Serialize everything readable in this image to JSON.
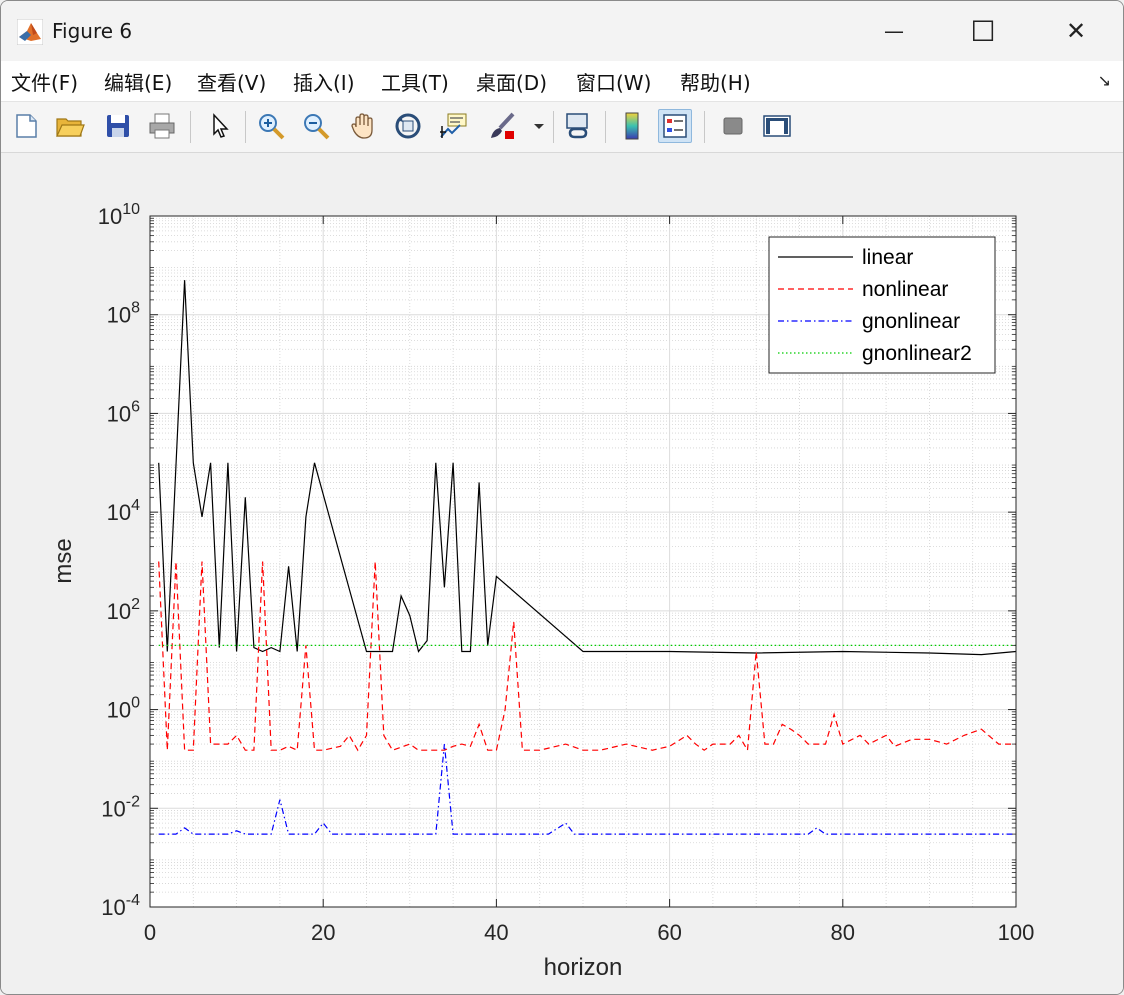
{
  "window": {
    "title": "Figure 6",
    "minimize_glyph": "—",
    "maximize_glyph": "☐",
    "close_glyph": "✕"
  },
  "menu": {
    "items": [
      "文件(F)",
      "编辑(E)",
      "查看(V)",
      "插入(I)",
      "工具(T)",
      "桌面(D)",
      "窗口(W)",
      "帮助(H)"
    ],
    "overflow_glyph": "↘"
  },
  "toolbar": {
    "icons": [
      "new-figure-icon",
      "open-file-icon",
      "save-icon",
      "print-icon",
      "pointer-icon",
      "zoom-in-icon",
      "zoom-out-icon",
      "pan-icon",
      "rotate-3d-icon",
      "data-cursor-icon",
      "brush-icon",
      "brush-dropdown-icon",
      "link-plot-icon",
      "colorbar-icon",
      "legend-icon",
      "hide-plot-tools-icon",
      "show-plot-tools-icon"
    ]
  },
  "chart_data": {
    "type": "line",
    "title": "",
    "xlabel": "horizon",
    "ylabel": "mse",
    "xlim": [
      0,
      100
    ],
    "ylim": [
      0.0001,
      10000000000
    ],
    "yscale": "log",
    "grid": true,
    "minor_grid": true,
    "legend_position": "top-right",
    "x_ticks": [
      "0",
      "20",
      "40",
      "60",
      "80",
      "100"
    ],
    "y_ticks": [
      {
        "base": "10",
        "exp": "-4"
      },
      {
        "base": "10",
        "exp": "-2"
      },
      {
        "base": "10",
        "exp": "0"
      },
      {
        "base": "10",
        "exp": "2"
      },
      {
        "base": "10",
        "exp": "4"
      },
      {
        "base": "10",
        "exp": "6"
      },
      {
        "base": "10",
        "exp": "8"
      },
      {
        "base": "10",
        "exp": "10"
      }
    ],
    "series": [
      {
        "name": "linear",
        "color": "#000000",
        "dash": "solid",
        "points": [
          [
            1,
            100000
          ],
          [
            2,
            15
          ],
          [
            4,
            500000000
          ],
          [
            5,
            100000
          ],
          [
            6,
            8000
          ],
          [
            7,
            100000
          ],
          [
            8,
            18
          ],
          [
            9,
            100000
          ],
          [
            10,
            15
          ],
          [
            11,
            20000
          ],
          [
            12,
            18
          ],
          [
            13,
            15
          ],
          [
            14,
            18
          ],
          [
            15,
            15
          ],
          [
            16,
            800
          ],
          [
            17,
            15
          ],
          [
            18,
            8000
          ],
          [
            19,
            100000
          ],
          [
            25,
            15
          ],
          [
            28,
            15
          ],
          [
            29,
            200
          ],
          [
            30,
            80
          ],
          [
            31,
            15
          ],
          [
            32,
            25
          ],
          [
            33,
            100000
          ],
          [
            34,
            300
          ],
          [
            35,
            100000
          ],
          [
            36,
            15
          ],
          [
            37,
            15
          ],
          [
            38,
            40000
          ],
          [
            39,
            20
          ],
          [
            40,
            500
          ],
          [
            50,
            15
          ],
          [
            60,
            15
          ],
          [
            70,
            14
          ],
          [
            80,
            15
          ],
          [
            90,
            14
          ],
          [
            96,
            13
          ],
          [
            100,
            15
          ]
        ]
      },
      {
        "name": "nonlinear",
        "color": "#ff0000",
        "dash": "dashed",
        "points": [
          [
            1,
            1000
          ],
          [
            2,
            0.15
          ],
          [
            3,
            1000
          ],
          [
            4,
            0.15
          ],
          [
            5,
            0.15
          ],
          [
            6,
            1000
          ],
          [
            7,
            0.2
          ],
          [
            8,
            0.2
          ],
          [
            9,
            0.2
          ],
          [
            10,
            0.3
          ],
          [
            11,
            0.15
          ],
          [
            12,
            0.15
          ],
          [
            13,
            1000
          ],
          [
            14,
            0.15
          ],
          [
            15,
            0.15
          ],
          [
            16,
            0.18
          ],
          [
            17,
            0.15
          ],
          [
            18,
            20
          ],
          [
            19,
            0.15
          ],
          [
            20,
            0.15
          ],
          [
            22,
            0.18
          ],
          [
            23,
            0.3
          ],
          [
            24,
            0.15
          ],
          [
            25,
            0.3
          ],
          [
            26,
            1000
          ],
          [
            27,
            0.3
          ],
          [
            28,
            0.15
          ],
          [
            30,
            0.2
          ],
          [
            31,
            0.15
          ],
          [
            33,
            0.15
          ],
          [
            34,
            0.15
          ],
          [
            35,
            0.18
          ],
          [
            36,
            0.2
          ],
          [
            37,
            0.18
          ],
          [
            38,
            0.5
          ],
          [
            39,
            0.15
          ],
          [
            40,
            0.15
          ],
          [
            41,
            1
          ],
          [
            42,
            60
          ],
          [
            43,
            0.15
          ],
          [
            45,
            0.15
          ],
          [
            48,
            0.2
          ],
          [
            50,
            0.15
          ],
          [
            52,
            0.15
          ],
          [
            55,
            0.2
          ],
          [
            58,
            0.15
          ],
          [
            60,
            0.18
          ],
          [
            62,
            0.3
          ],
          [
            63,
            0.2
          ],
          [
            64,
            0.15
          ],
          [
            65,
            0.2
          ],
          [
            67,
            0.2
          ],
          [
            68,
            0.3
          ],
          [
            69,
            0.15
          ],
          [
            70,
            15
          ],
          [
            71,
            0.2
          ],
          [
            72,
            0.2
          ],
          [
            73,
            0.5
          ],
          [
            74,
            0.4
          ],
          [
            75,
            0.3
          ],
          [
            76,
            0.2
          ],
          [
            77,
            0.2
          ],
          [
            78,
            0.2
          ],
          [
            79,
            0.8
          ],
          [
            80,
            0.2
          ],
          [
            82,
            0.3
          ],
          [
            83,
            0.2
          ],
          [
            85,
            0.3
          ],
          [
            86,
            0.18
          ],
          [
            88,
            0.25
          ],
          [
            90,
            0.25
          ],
          [
            92,
            0.2
          ],
          [
            94,
            0.3
          ],
          [
            96,
            0.4
          ],
          [
            98,
            0.2
          ],
          [
            100,
            0.2
          ]
        ]
      },
      {
        "name": "gnonlinear",
        "color": "#0000ff",
        "dash": "dashdot",
        "points": [
          [
            1,
            0.003
          ],
          [
            3,
            0.003
          ],
          [
            4,
            0.004
          ],
          [
            5,
            0.003
          ],
          [
            7,
            0.003
          ],
          [
            9,
            0.003
          ],
          [
            10,
            0.0035
          ],
          [
            11,
            0.003
          ],
          [
            13,
            0.003
          ],
          [
            14,
            0.003
          ],
          [
            15,
            0.015
          ],
          [
            16,
            0.003
          ],
          [
            19,
            0.003
          ],
          [
            20,
            0.005
          ],
          [
            21,
            0.003
          ],
          [
            25,
            0.003
          ],
          [
            29,
            0.003
          ],
          [
            30,
            0.003
          ],
          [
            33,
            0.003
          ],
          [
            34,
            0.2
          ],
          [
            35,
            0.003
          ],
          [
            40,
            0.003
          ],
          [
            44,
            0.003
          ],
          [
            46,
            0.003
          ],
          [
            48,
            0.005
          ],
          [
            49,
            0.003
          ],
          [
            55,
            0.003
          ],
          [
            60,
            0.003
          ],
          [
            70,
            0.003
          ],
          [
            76,
            0.003
          ],
          [
            77,
            0.004
          ],
          [
            78,
            0.003
          ],
          [
            85,
            0.003
          ],
          [
            90,
            0.003
          ],
          [
            95,
            0.003
          ],
          [
            98,
            0.003
          ],
          [
            100,
            0.003
          ]
        ]
      },
      {
        "name": "gnonlinear2",
        "color": "#00cc00",
        "dash": "dotted",
        "points": [
          [
            1,
            20
          ],
          [
            100,
            20
          ]
        ]
      }
    ]
  }
}
